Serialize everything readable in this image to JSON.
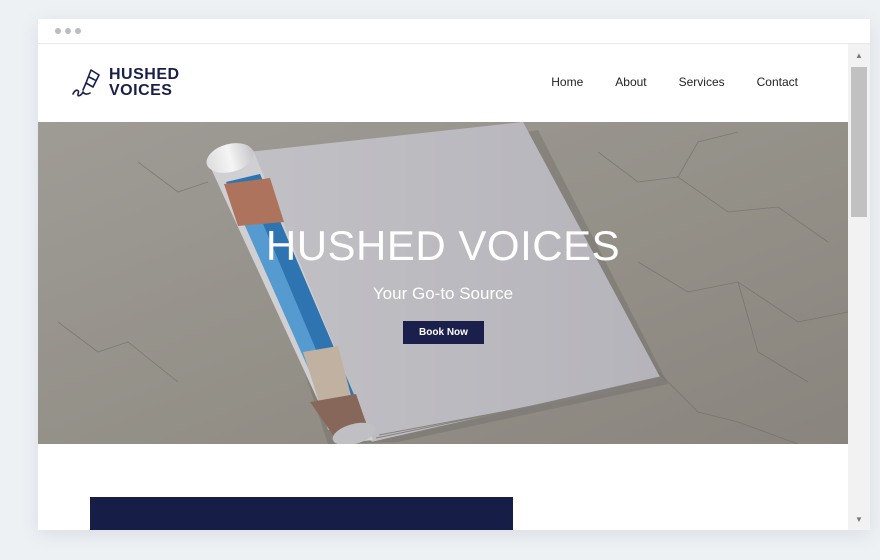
{
  "window": {
    "controls": [
      "dot",
      "dot",
      "dot"
    ]
  },
  "header": {
    "logo": {
      "line1": "HUSHED",
      "line2": "VOICES",
      "icon": "fountain-pen-icon"
    },
    "nav": [
      {
        "label": "Home"
      },
      {
        "label": "About"
      },
      {
        "label": "Services"
      },
      {
        "label": "Contact"
      }
    ]
  },
  "hero": {
    "title": "HUSHED VOICES",
    "subtitle": "Your Go-to Source",
    "button_label": "Book Now",
    "background": "rolled-magazine-on-concrete"
  },
  "colors": {
    "brand_navy": "#1b1f4b",
    "section_block": "#161d47",
    "page_bg": "#eef1f4"
  },
  "scrollbar": {
    "up_icon": "arrow-up-icon",
    "down_icon": "arrow-down-icon"
  }
}
